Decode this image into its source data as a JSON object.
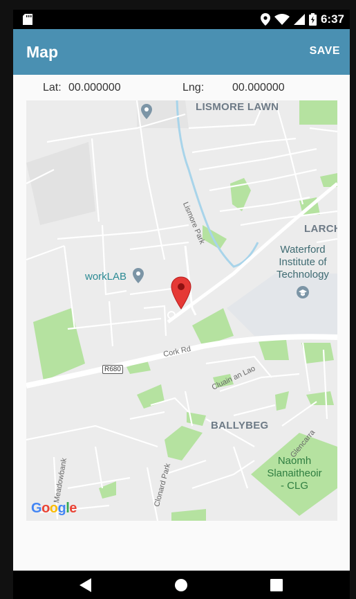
{
  "status_bar": {
    "time": "6:37",
    "icons": [
      "sd-card-icon",
      "location-icon",
      "wifi-icon",
      "signal-icon",
      "battery-icon"
    ]
  },
  "app_bar": {
    "title": "Map",
    "save_label": "SAVE",
    "color": "#4a90b2"
  },
  "coordinates": {
    "lat_label": "Lat:",
    "lat_value": "00.000000",
    "lng_label": "Lng:",
    "lng_value": "00.000000"
  },
  "map": {
    "labels": {
      "lismore_lawn": "LISMORE LAWN",
      "larch": "LARCH",
      "lismore_park": "Lismore Park",
      "wit_line1": "Waterford",
      "wit_line2": "Institute of",
      "wit_line3": "Technology",
      "worklab": "workLAB",
      "cork_rd": "Cork Rd",
      "r680": "R680",
      "cluain": "Cluain an Lao",
      "ballybeg": "BALLYBEG",
      "glencarra": "Glencarra",
      "naomh_line1": "Naomh",
      "naomh_line2": "Slanaitheoir",
      "naomh_line3": "- CLG",
      "meadowbank": "Meadowbank",
      "clonard_park": "Clonard Park",
      "google": "Google"
    },
    "colors": {
      "background": "#ececec",
      "road": "#ffffff",
      "park": "#b5e2a0",
      "water": "#a8d4ea",
      "campus": "#e3e6ea",
      "marker": "#e53935"
    }
  },
  "nav_bar": {
    "buttons": [
      "back-icon",
      "home-icon",
      "recents-icon"
    ]
  }
}
